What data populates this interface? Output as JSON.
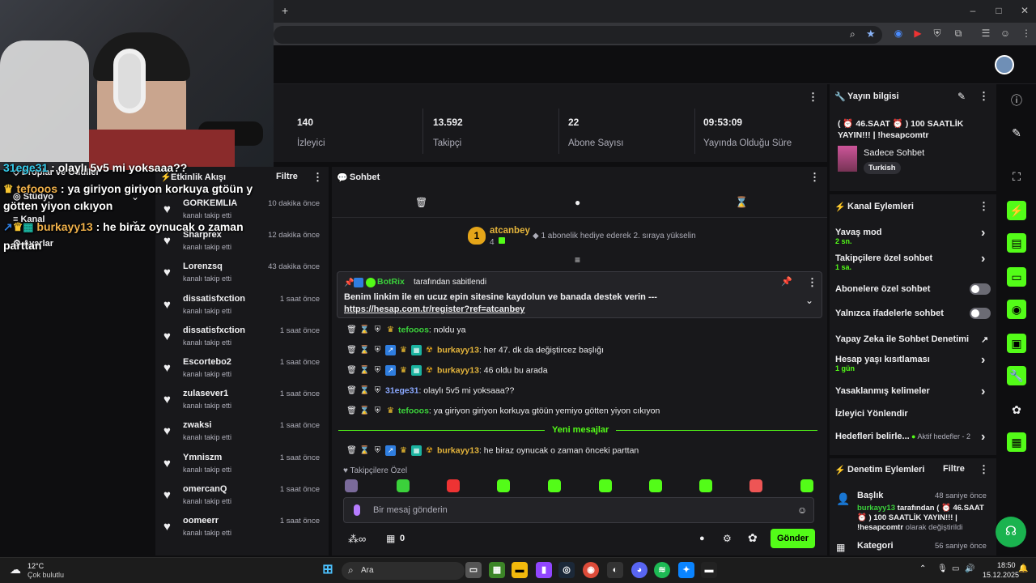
{
  "browser": {
    "new_tab": "+",
    "window_buttons": [
      "–",
      "□",
      "✕"
    ]
  },
  "stats": [
    {
      "value": "140",
      "label": "İzleyici"
    },
    {
      "value": "13.592",
      "label": "Takipçi"
    },
    {
      "value": "22",
      "label": "Abone Sayısı"
    },
    {
      "value": "09:53:09",
      "label": "Yayında Olduğu Süre"
    }
  ],
  "sidebar_overlay_menu": [
    "Droplar ve Ödüller",
    "Stüdyo",
    "Kanal",
    "Ayarlar"
  ],
  "activity": {
    "title": "Etkinlik Akışı",
    "filter": "Filtre",
    "items": [
      {
        "name": "GORKEMLIA",
        "time": "10 dakika önce",
        "sub": "kanalı takip etti"
      },
      {
        "name": "Sharprex",
        "time": "12 dakika önce",
        "sub": "kanalı takip etti"
      },
      {
        "name": "Lorenzsq",
        "time": "43 dakika önce",
        "sub": "kanalı takip etti"
      },
      {
        "name": "dissatisfxction",
        "time": "1 saat önce",
        "sub": "kanalı takip etti"
      },
      {
        "name": "dissatisfxction",
        "time": "1 saat önce",
        "sub": "kanalı takip etti"
      },
      {
        "name": "Escortebo2",
        "time": "1 saat önce",
        "sub": "kanalı takip etti"
      },
      {
        "name": "zulasever1",
        "time": "1 saat önce",
        "sub": "kanalı takip etti"
      },
      {
        "name": "zwaksi",
        "time": "1 saat önce",
        "sub": "kanalı takip etti"
      },
      {
        "name": "Ymniszm",
        "time": "1 saat önce",
        "sub": "kanalı takip etti"
      },
      {
        "name": "omercanQ",
        "time": "1 saat önce",
        "sub": "kanalı takip etti"
      },
      {
        "name": "oomeerr",
        "time": "1 saat önce",
        "sub": "kanalı takip etti"
      }
    ]
  },
  "chat": {
    "title": "Sohbet",
    "leader": {
      "rank": "1",
      "name": "atcanbey",
      "count": "4",
      "text": "1 abonelik hediye ederek 2. sıraya yükselin"
    },
    "pinned": {
      "by": "BotRix",
      "by_suffix": "tarafından sabitlendi",
      "text": "Benim linkim ile en ucuz epin sitesine kaydolun ve banada destek verin --- ",
      "link": "https://hesap.com.tr/register?ref=atcanbey"
    },
    "messages": [
      {
        "user": "tefooos",
        "text": "noldu ya"
      },
      {
        "user": "burkayy13",
        "text": "her 47. dk da değiştircez başlığı"
      },
      {
        "user": "burkayy13",
        "text": "46 oldu bu arada"
      },
      {
        "user": "31ege31",
        "text": "olaylı 5v5 mi yoksaaa??"
      },
      {
        "user": "tefooos",
        "text": "ya giriyon giriyon korkuya gtöün yemiyo götten yiyon cıkıyon"
      }
    ],
    "new_messages": "Yeni mesajlar",
    "last_message": {
      "user": "burkayy13",
      "text": "he biraz oynucak o zaman önceki parttan"
    },
    "followers_only": "Takipçilere Özel",
    "input_placeholder": "Bir mesaj gönderin",
    "points": "0",
    "send": "Gönder"
  },
  "stream_info": {
    "title": "Yayın bilgisi",
    "stream_title": "( ⏰ 46.SAAT ⏰ ) 100 SAATLİK YAYIN!!! | !hesapcomtr",
    "category": "Sadece Sohbet",
    "tag": "Turkish"
  },
  "channel_actions": {
    "title": "Kanal Eylemleri",
    "items": [
      {
        "label": "Yavaş mod",
        "sub": "2 sn."
      },
      {
        "label": "Takipçilere özel sohbet",
        "sub": "1 sa."
      },
      {
        "label": "Abonelere özel sohbet",
        "sub": ""
      },
      {
        "label": "Yalnızca ifadelerle sohbet",
        "sub": ""
      },
      {
        "label": "Yapay Zeka ile Sohbet Denetimi",
        "sub": ""
      },
      {
        "label": "Hesap yaşı kısıtlaması",
        "sub": "1 gün"
      },
      {
        "label": "Yasaklanmış kelimeler",
        "sub": ""
      },
      {
        "label": "İzleyici Yönlendir",
        "sub": ""
      },
      {
        "label": "Hedefleri belirle...",
        "sub": "Aktif hedefler - 2"
      }
    ]
  },
  "mod_actions": {
    "title": "Denetim Eylemleri",
    "filter": "Filtre",
    "items": [
      {
        "label": "Başlık",
        "time": "48 saniye önce",
        "user": "burkayy13",
        "text": " tarafından ( ⏰ 46.SAAT ⏰ ) 100 SAATLİK YAYIN!!! | !hesapcomtr",
        "suffix": " olarak değiştirildi"
      },
      {
        "label": "Kategori",
        "time": "56 saniye önce"
      }
    ]
  },
  "overlay": [
    {
      "user": "31ege31",
      "text": " : olaylı 5v5 mi yoksaaa??"
    },
    {
      "user": "tefooos",
      "text": " : ya giriyon giriyon korkuya gtöün y"
    },
    {
      "user": "",
      "text": "götten yiyon cıkıyon"
    },
    {
      "user": "burkayy13",
      "text": " : he biraz oynucak o zaman"
    },
    {
      "user": "",
      "text": "parttan"
    }
  ],
  "taskbar": {
    "weather_temp": "12°C",
    "weather_desc": "Çok bulutlu",
    "search": "Ara",
    "time": "18:50",
    "date": "15.12.2025"
  },
  "colors": {
    "accent": "#53fc18",
    "panel": "#18181b",
    "bg": "#0e0e10"
  }
}
